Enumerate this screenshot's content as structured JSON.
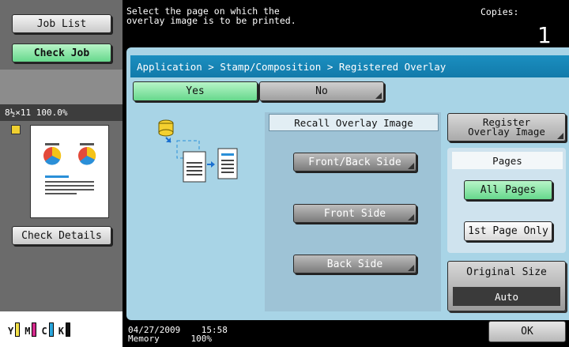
{
  "left": {
    "job_list": "Job List",
    "check_job": "Check Job",
    "preview_info": "8½×11  100.0%",
    "check_details": "Check Details",
    "toner": [
      "Y",
      "M",
      "C",
      "K"
    ]
  },
  "header": {
    "message": "Select the page on which the\noverlay image is to be printed.",
    "copies_label": "Copies:",
    "copies_value": "1"
  },
  "breadcrumb": "Application > Stamp/Composition > Registered Overlay",
  "toggle": {
    "yes": "Yes",
    "no": "No",
    "selected": "Yes"
  },
  "recall": {
    "title": "Recall Overlay Image",
    "options": [
      "Front/Back Side",
      "Front Side",
      "Back Side"
    ]
  },
  "register": "Register\nOverlay Image",
  "pages": {
    "label": "Pages",
    "all": "All Pages",
    "first": "1st Page Only",
    "selected": "All Pages"
  },
  "original_size": {
    "label": "Original Size",
    "value": "Auto"
  },
  "footer": {
    "date": "04/27/2009",
    "time": "15:58",
    "memory_label": "Memory",
    "memory_value": "100%",
    "ok": "OK"
  },
  "colors": {
    "accent": "#1b8fc0",
    "selected": "#66d88c",
    "panel": "#a8d4e6"
  }
}
